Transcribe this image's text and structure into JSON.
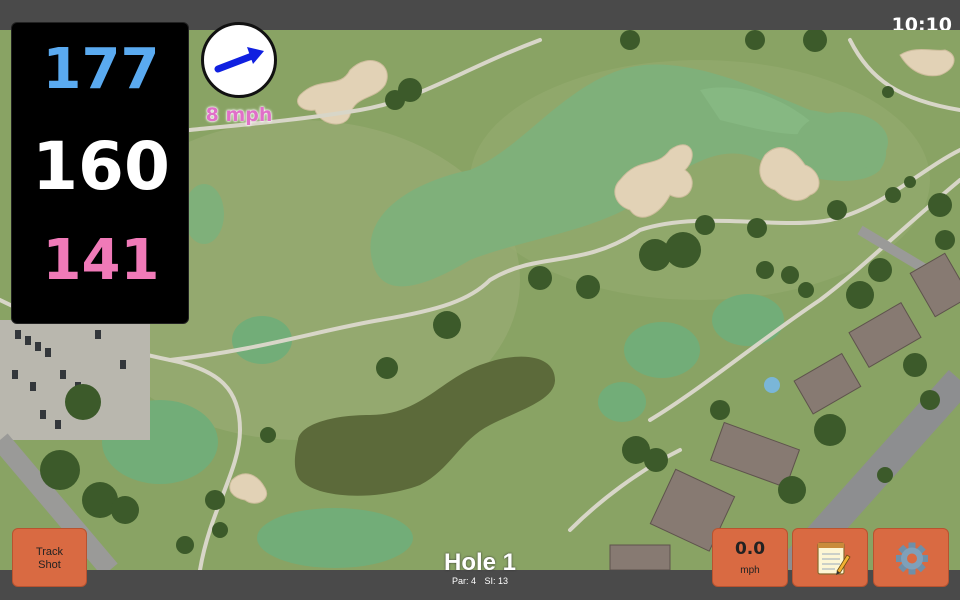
{
  "status_bar": {
    "time": "10:10"
  },
  "distances": {
    "back": "177",
    "middle": "160",
    "front": "141"
  },
  "wind": {
    "speed_label": "8 mph",
    "icon": "wind-arrow-icon"
  },
  "buttons": {
    "track_shot_line1": "Track",
    "track_shot_line2": "Shot",
    "speed_value": "0.0",
    "speed_unit": "mph",
    "notes_icon": "notepad-icon",
    "settings_icon": "gear-icon"
  },
  "hole": {
    "title": "Hole 1",
    "par": "Par: 4",
    "si": "SI: 13"
  },
  "colors": {
    "back": "#5aaaf0",
    "middle": "#ffffff",
    "front": "#f07ab8",
    "button": "#d96a42",
    "wind": "#e070c8"
  }
}
